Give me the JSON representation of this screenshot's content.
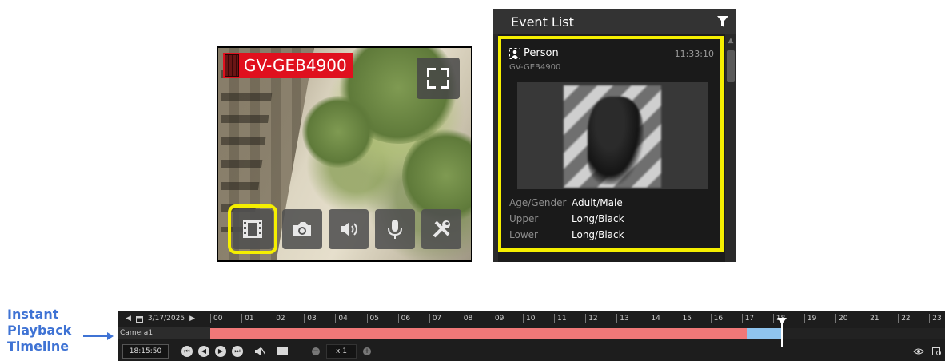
{
  "camera": {
    "name": "GV-GEB4900"
  },
  "event_list": {
    "title": "Event List",
    "event": {
      "type": "Person",
      "time": "11:33:10",
      "camera": "GV-GEB4900",
      "attributes": [
        {
          "key": "Age/Gender",
          "value": "Adult/Male"
        },
        {
          "key": "Upper",
          "value": "Long/Black"
        },
        {
          "key": "Lower",
          "value": "Long/Black"
        }
      ]
    }
  },
  "annotation": {
    "line1": "Instant",
    "line2": "Playback",
    "line3": "Timeline"
  },
  "timeline": {
    "date": "3/17/2025",
    "camera_label": "Camera1",
    "hours": [
      "00",
      "01",
      "02",
      "03",
      "04",
      "05",
      "06",
      "07",
      "08",
      "09",
      "10",
      "11",
      "12",
      "13",
      "14",
      "15",
      "16",
      "17",
      "18",
      "19",
      "20",
      "21",
      "22",
      "23"
    ],
    "current_time": "18:15:50",
    "speed": "x 1",
    "recorded_until_hour": 17.15,
    "playback_segment_hours": [
      17.15,
      18.25
    ],
    "playhead_hour": 18.25,
    "colors": {
      "recorded": "#f07878",
      "playback_segment": "#8fc4ee",
      "highlight": "#f5ef00",
      "annotation": "#3f73d4",
      "camera_tag": "#e0101e"
    }
  },
  "icons": [
    "film-icon",
    "camera-icon",
    "speaker-icon",
    "microphone-icon",
    "settings-icon",
    "fullscreen-icon",
    "filter-icon",
    "person-icon",
    "calendar-icon",
    "mute-icon"
  ]
}
